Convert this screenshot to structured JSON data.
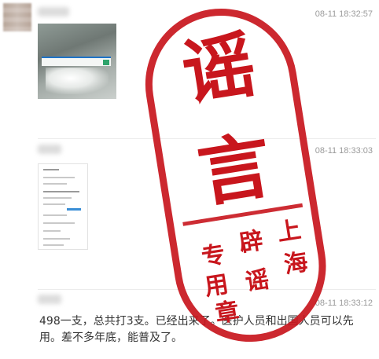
{
  "colors": {
    "stamp_red": "#c8161d",
    "timestamp_gray": "#9a9a9a",
    "text_dark": "#333333"
  },
  "messages": [
    {
      "timestamp": "08-11 18:32:57",
      "attachment": "photo",
      "avatar_icon": "blurred-avatar"
    },
    {
      "timestamp": "08-11 18:33:03",
      "attachment": "screenshot"
    },
    {
      "timestamp": "08-11 18:33:12",
      "text": "498一支，总共打3支。已经出来了。医护人员和出国人员可以先用。差不多年底，能普及了。"
    }
  ],
  "stamp": {
    "big_char_1": "谣",
    "big_char_2": "言",
    "small_chars": [
      "专",
      "辟",
      "上",
      "用",
      "谣",
      "海",
      "章"
    ]
  }
}
